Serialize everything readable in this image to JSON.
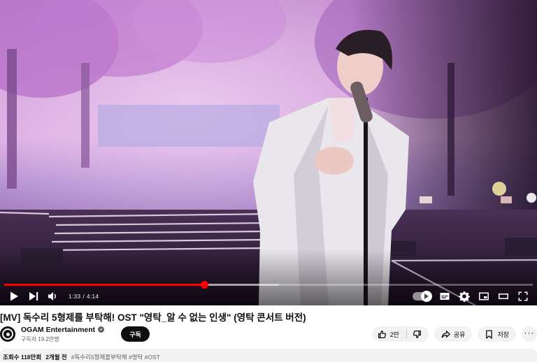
{
  "player": {
    "progress": {
      "played_fraction": 0.378,
      "buffered_fraction": 0.52
    },
    "time": {
      "current": "1:33",
      "separator": "/",
      "duration": "4:14"
    },
    "icons": {
      "play": "play-icon",
      "next": "next-icon",
      "volume": "volume-icon",
      "autoplay": "autoplay-toggle",
      "captions": "captions-icon",
      "settings": "gear-icon",
      "miniplayer": "miniplayer-icon",
      "theater": "theater-icon",
      "fullscreen": "fullscreen-icon"
    }
  },
  "video": {
    "title": "[MV] 독수리 5형제를 부탁해! OST \"영탁_알 수 없는 인생\" (영탁 콘서트 버전)"
  },
  "channel": {
    "name": "OGAM Entertainment",
    "subscribers": "구독자 19.2만명",
    "subscribe_label": "구독"
  },
  "actions": {
    "like_count": "2만",
    "share_label": "공유",
    "save_label": "저장",
    "more_label": "···"
  },
  "description": {
    "views": "조회수 118만회",
    "age": "2개월 전",
    "tags": "#독수리5형제를부탁해 #영탁 #OST"
  },
  "colors": {
    "accent": "#ff0000",
    "subscribe_bg": "#0f0f0f",
    "pill_bg": "#f2f2f2",
    "secondary_text": "#606060"
  }
}
